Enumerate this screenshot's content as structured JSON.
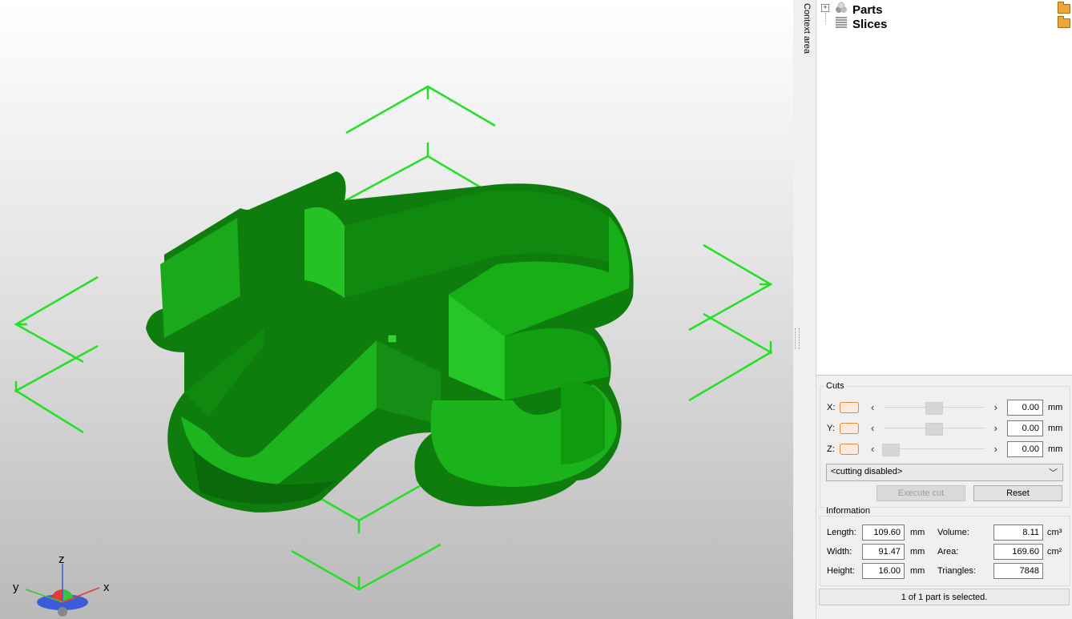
{
  "context_area": {
    "label": "Context area"
  },
  "tree": {
    "items": [
      {
        "label": "Parts",
        "icon": "parts-icon"
      },
      {
        "label": "Slices",
        "icon": "slices-icon"
      }
    ]
  },
  "cuts": {
    "title": "Cuts",
    "axes": [
      {
        "label": "X:",
        "value": "0.00",
        "unit": "mm"
      },
      {
        "label": "Y:",
        "value": "0.00",
        "unit": "mm"
      },
      {
        "label": "Z:",
        "value": "0.00",
        "unit": "mm"
      }
    ],
    "mode_selected": "<cutting disabled>",
    "execute_label": "Execute cut",
    "reset_label": "Reset"
  },
  "information": {
    "title": "Information",
    "length": {
      "label": "Length:",
      "value": "109.60",
      "unit": "mm"
    },
    "width": {
      "label": "Width:",
      "value": "91.47",
      "unit": "mm"
    },
    "height": {
      "label": "Height:",
      "value": "16.00",
      "unit": "mm"
    },
    "volume": {
      "label": "Volume:",
      "value": "8.11",
      "unit": "cm³"
    },
    "area": {
      "label": "Area:",
      "value": "169.60",
      "unit": "cm²"
    },
    "triangles": {
      "label": "Triangles:",
      "value": "7848"
    }
  },
  "status": {
    "text": "1 of 1 part is selected."
  },
  "orientation": {
    "x": "x",
    "y": "y",
    "z": "z"
  },
  "colors": {
    "model": "#18b518",
    "bbox": "#22e022",
    "accent": "#e0893a"
  }
}
